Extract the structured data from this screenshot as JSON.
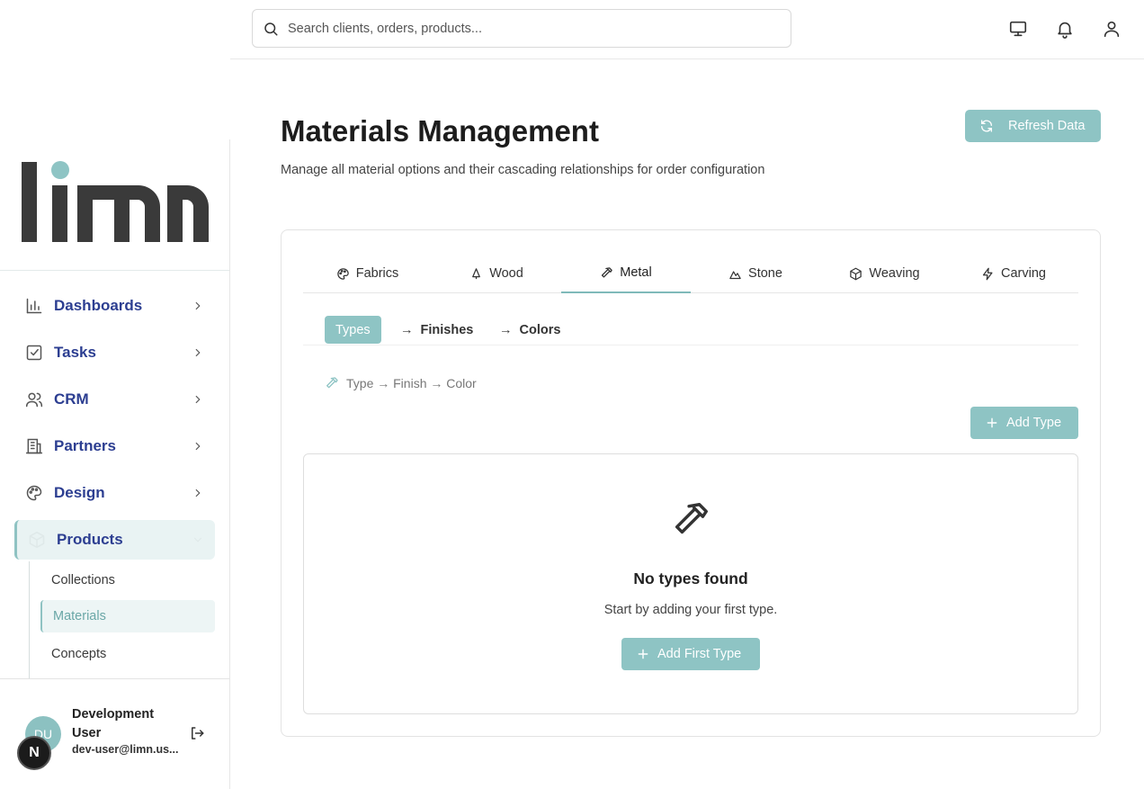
{
  "search": {
    "placeholder": "Search clients, orders, products..."
  },
  "topbar": {
    "icons": [
      "monitor-icon",
      "bell-icon",
      "user-icon"
    ]
  },
  "brand": {
    "logo_text": "limn",
    "logo_color": "#3a3a3a",
    "dot_color": "#8ec4c4"
  },
  "sidebar": {
    "items": [
      {
        "label": "Dashboards",
        "icon": "bar-chart-icon"
      },
      {
        "label": "Tasks",
        "icon": "checkbox-icon"
      },
      {
        "label": "CRM",
        "icon": "users-icon"
      },
      {
        "label": "Partners",
        "icon": "building-icon"
      },
      {
        "label": "Design",
        "icon": "palette-icon"
      },
      {
        "label": "Products",
        "icon": "box-icon",
        "expanded": true
      }
    ],
    "subitems": [
      {
        "label": "Collections"
      },
      {
        "label": "Materials",
        "active": true
      },
      {
        "label": "Concepts"
      }
    ]
  },
  "user": {
    "initials": "DU",
    "name": "Development User",
    "email": "dev-user@limn.us..."
  },
  "dev_badge": "N",
  "header": {
    "title": "Materials Management",
    "subtitle": "Manage all material options and their cascading relationships for order configuration",
    "refresh_label": "Refresh Data"
  },
  "tabs": [
    {
      "label": "Fabrics",
      "icon": "palette-icon"
    },
    {
      "label": "Wood",
      "icon": "tree-icon"
    },
    {
      "label": "Metal",
      "icon": "hammer-icon",
      "active": true
    },
    {
      "label": "Stone",
      "icon": "mountain-icon"
    },
    {
      "label": "Weaving",
      "icon": "package-icon"
    },
    {
      "label": "Carving",
      "icon": "zap-icon"
    }
  ],
  "subtabs": {
    "types": "Types",
    "finishes": "Finishes",
    "colors": "Colors",
    "arrow": "→"
  },
  "hierarchy_text": "Type → Finish → Color",
  "add_type_label": "Add Type",
  "empty": {
    "title": "No types found",
    "text": "Start by adding your first type.",
    "button_label": "Add First Type"
  },
  "colors": {
    "accent": "#8ec4c4",
    "nav_text": "#2c3e91"
  }
}
